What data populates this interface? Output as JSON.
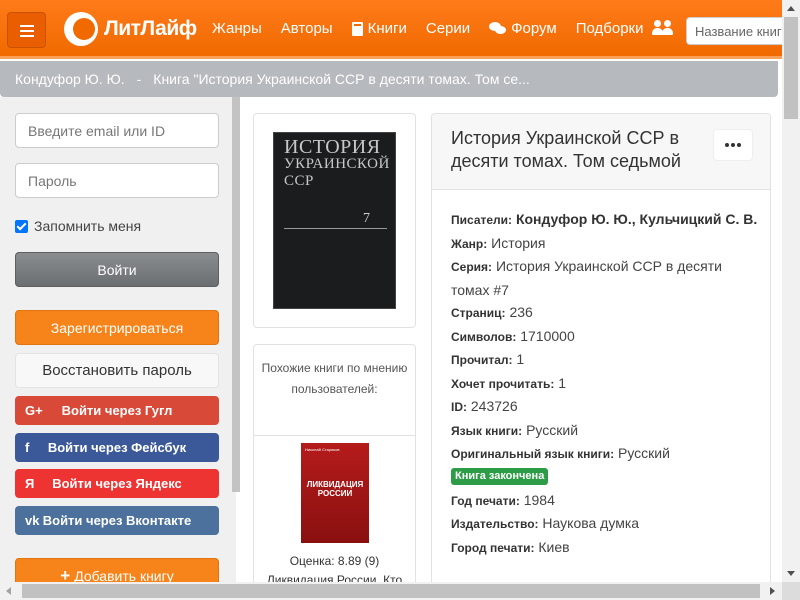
{
  "navbar": {
    "logo_text": "ЛитЛайф",
    "items": [
      {
        "label": "Жанры"
      },
      {
        "label": "Авторы"
      },
      {
        "label": "Книги",
        "icon": "book-icon"
      },
      {
        "label": "Серии"
      },
      {
        "label": "Форум",
        "icon": "chat-icon"
      },
      {
        "label": "Подборки"
      }
    ],
    "search_placeholder": "Название книги"
  },
  "breadcrumb": {
    "author": "Кондуфор Ю. Ю.",
    "separator": "-",
    "book": "Книга \"История Украинской ССР в десяти томах. Том се..."
  },
  "sidebar": {
    "email_placeholder": "Введите email или ID",
    "password_placeholder": "Пароль",
    "remember_label": "Запомнить меня",
    "remember_checked": true,
    "login_label": "Войти",
    "register_label": "Зарегистрироваться",
    "restore_label": "Восстановить пароль",
    "social": {
      "google": {
        "icon_text": "G+",
        "label": "Войти через Гугл"
      },
      "facebook": {
        "icon_text": "f",
        "label": "Войти через Фейсбук"
      },
      "yandex": {
        "icon_text": "Я",
        "label": "Войти через Яндекс"
      },
      "vk": {
        "icon_text": "vk",
        "label": "Войти через Вконтакте"
      }
    },
    "add_book_label": "Добавить книгу"
  },
  "cover": {
    "title_line1": "ИСТОРИЯ",
    "title_line2": "УКРАИНСКОЙ",
    "title_line3": "ССР",
    "volume": "7"
  },
  "similar": {
    "title": "Похожие книги по мнению пользователей:",
    "book": {
      "cover_author": "Николай Стариков",
      "cover_title": "ЛИКВИДАЦИЯ РОССИИ",
      "rating": "Оценка: 8.89 (9)",
      "name": "Ликвидация России. Кто"
    }
  },
  "book": {
    "title": "История Украинской ССР в десяти томах. Том седьмой",
    "authors_label": "Писатели:",
    "authors": "Кондуфор Ю. Ю., Кульчицкий С. В.",
    "genre_label": "Жанр:",
    "genre": "История",
    "series_label": "Серия:",
    "series": "История Украинской ССР в десяти томах #7",
    "pages_label": "Страниц:",
    "pages": "236",
    "symbols_label": "Символов:",
    "symbols": "1710000",
    "read_label": "Прочитал:",
    "read": "1",
    "want_label": "Хочет прочитать:",
    "want": "1",
    "id_label": "ID:",
    "id": "243726",
    "language_label": "Язык книги:",
    "language": "Русский",
    "orig_language_label": "Оригинальный язык книги:",
    "orig_language": "Русский",
    "status_badge": "Книга закончена",
    "year_label": "Год печати:",
    "year": "1984",
    "publisher_label": "Издательство:",
    "publisher": "Наукова думка",
    "city_label": "Город печати:",
    "city": "Киев"
  },
  "colors": {
    "brand_orange": "#f06a00",
    "breadcrumb_gray": "#b6b9bd",
    "badge_green": "#2d9c46"
  }
}
